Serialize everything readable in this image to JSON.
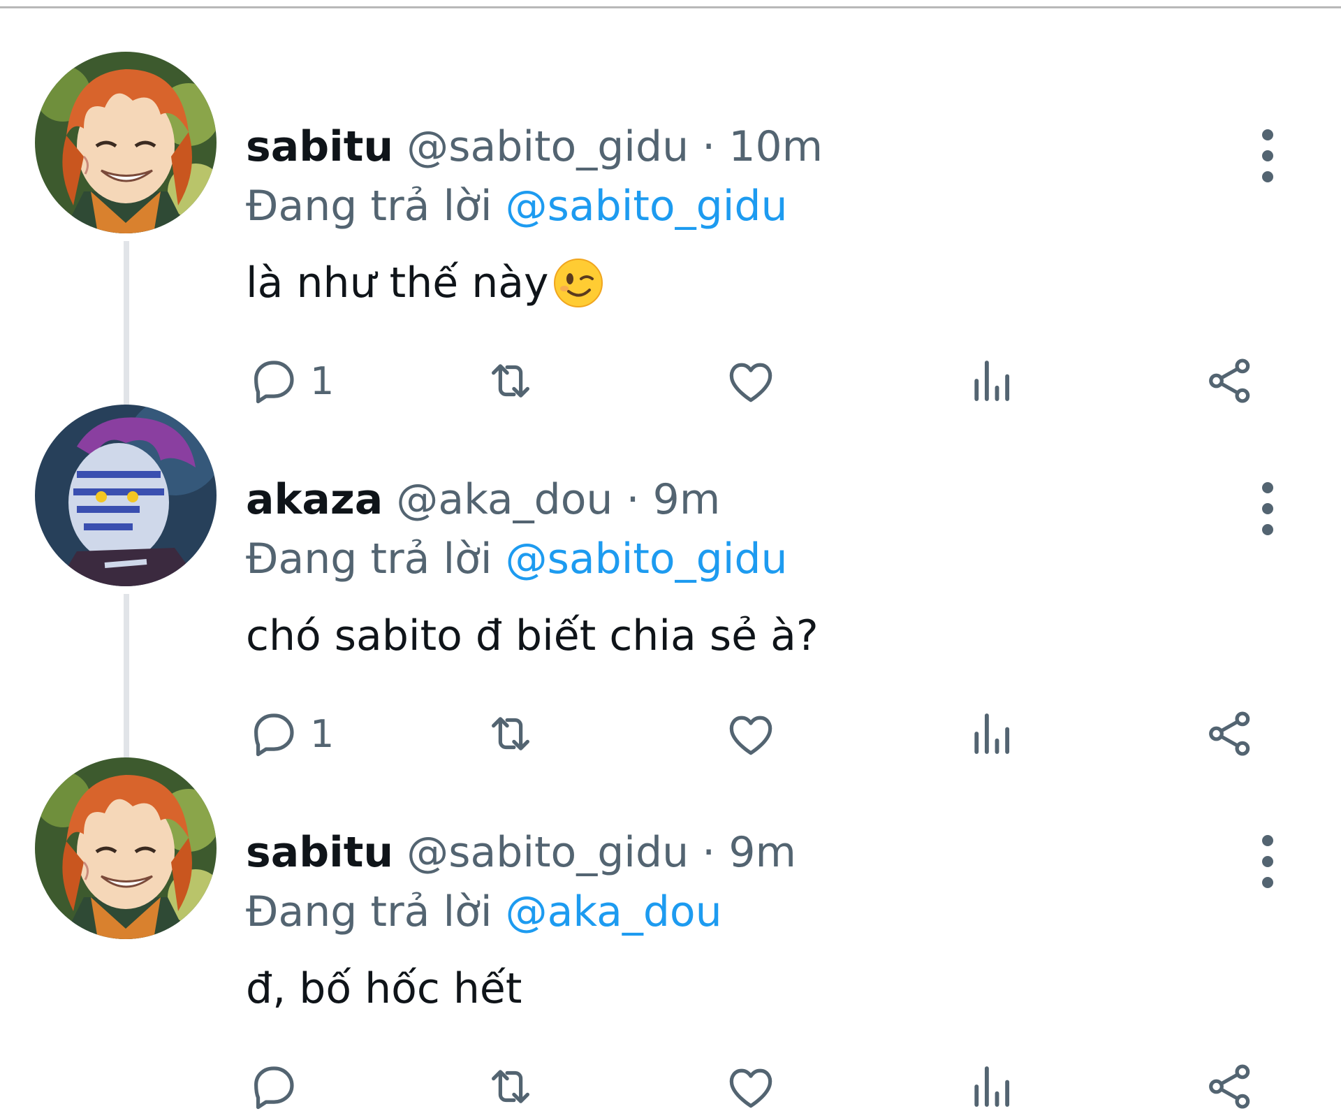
{
  "tweets": [
    {
      "display_name": "sabitu",
      "handle": "@sabito_gidu",
      "separator": "·",
      "time": "10m",
      "replying_prefix": "Đang trả lời",
      "replying_to": "@sabito_gidu",
      "text": "là như thế này",
      "emoji": "winking-face-emoji",
      "reply_count": "1",
      "avatar": "sabito-avatar"
    },
    {
      "display_name": "akaza",
      "handle": "@aka_dou",
      "separator": "·",
      "time": "9m",
      "replying_prefix": "Đang trả lời",
      "replying_to": "@sabito_gidu",
      "text": "chó sabito đ biết chia sẻ à?",
      "reply_count": "1",
      "avatar": "akaza-avatar"
    },
    {
      "display_name": "sabitu",
      "handle": "@sabito_gidu",
      "separator": "·",
      "time": "9m",
      "replying_prefix": "Đang trả lời",
      "replying_to": "@aka_dou",
      "text": "đ, bố hốc hết",
      "reply_count": "",
      "avatar": "sabito-avatar"
    }
  ],
  "colors": {
    "name": "#0f1419",
    "secondary": "#536471",
    "mention": "#1d9bf0",
    "thread_line": "#e1e4e8"
  },
  "icons": [
    "reply-icon",
    "retweet-icon",
    "like-icon",
    "views-icon",
    "share-icon",
    "more-options-icon"
  ]
}
